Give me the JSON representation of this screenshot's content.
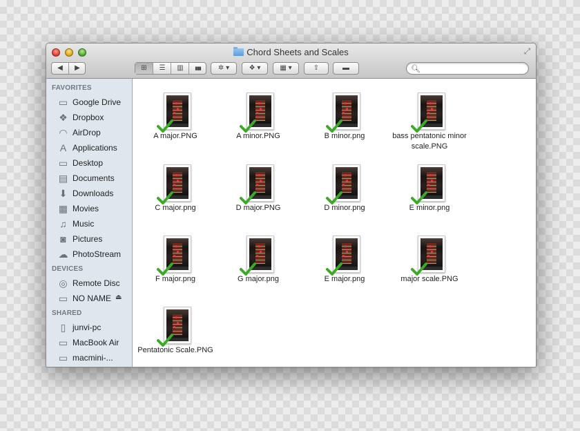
{
  "window": {
    "title": "Chord Sheets and Scales"
  },
  "toolbar": {
    "back_glyph": "◀",
    "forward_glyph": "▶",
    "view_icons_glyph": "⊞",
    "view_list_glyph": "☰",
    "view_columns_glyph": "▥",
    "view_coverflow_glyph": "▮▮▮",
    "action_glyph": "✲ ▾",
    "dropbox_glyph": "❖ ▾",
    "arrange_glyph": "▦ ▾",
    "share_glyph": "⇧",
    "tags_glyph": "▬",
    "search_placeholder": ""
  },
  "sidebar": {
    "favorites_header": "FAVORITES",
    "favorites": [
      {
        "label": "Google Drive",
        "icon": "folder-icon",
        "glyph": "▭"
      },
      {
        "label": "Dropbox",
        "icon": "dropbox-icon",
        "glyph": "❖"
      },
      {
        "label": "AirDrop",
        "icon": "airdrop-icon",
        "glyph": "◠"
      },
      {
        "label": "Applications",
        "icon": "applications-icon",
        "glyph": "A"
      },
      {
        "label": "Desktop",
        "icon": "desktop-icon",
        "glyph": "▭"
      },
      {
        "label": "Documents",
        "icon": "documents-icon",
        "glyph": "▤"
      },
      {
        "label": "Downloads",
        "icon": "downloads-icon",
        "glyph": "⬇"
      },
      {
        "label": "Movies",
        "icon": "movies-icon",
        "glyph": "▦"
      },
      {
        "label": "Music",
        "icon": "music-icon",
        "glyph": "♫"
      },
      {
        "label": "Pictures",
        "icon": "pictures-icon",
        "glyph": "◙"
      },
      {
        "label": "PhotoStream",
        "icon": "photostream-icon",
        "glyph": "☁"
      }
    ],
    "devices_header": "DEVICES",
    "devices": [
      {
        "label": "Remote Disc",
        "icon": "remote-disc-icon",
        "glyph": "◎"
      },
      {
        "label": "NO NAME",
        "icon": "drive-icon",
        "glyph": "▭",
        "eject": "⏏"
      }
    ],
    "shared_header": "SHARED",
    "shared": [
      {
        "label": "junvi-pc",
        "icon": "pc-icon",
        "glyph": "▯"
      },
      {
        "label": "MacBook Air",
        "icon": "laptop-icon",
        "glyph": "▭"
      },
      {
        "label": "macmini-...",
        "icon": "macmini-icon",
        "glyph": "▭"
      }
    ]
  },
  "files": [
    {
      "name": "A major.PNG"
    },
    {
      "name": "A minor.PNG"
    },
    {
      "name": "B minor.png"
    },
    {
      "name": "bass pentatonic minor scale.PNG"
    },
    {
      "name": "C major.png"
    },
    {
      "name": "D major.PNG"
    },
    {
      "name": "D minor.png"
    },
    {
      "name": "E minor.png"
    },
    {
      "name": "F major.png"
    },
    {
      "name": "G major.png"
    },
    {
      "name": "E major.png"
    },
    {
      "name": "major scale.PNG"
    },
    {
      "name": "Pentatonic Scale.PNG"
    }
  ],
  "colors": {
    "sync_check": "#3fa82a",
    "sidebar_bg": "#e0e6ee"
  }
}
